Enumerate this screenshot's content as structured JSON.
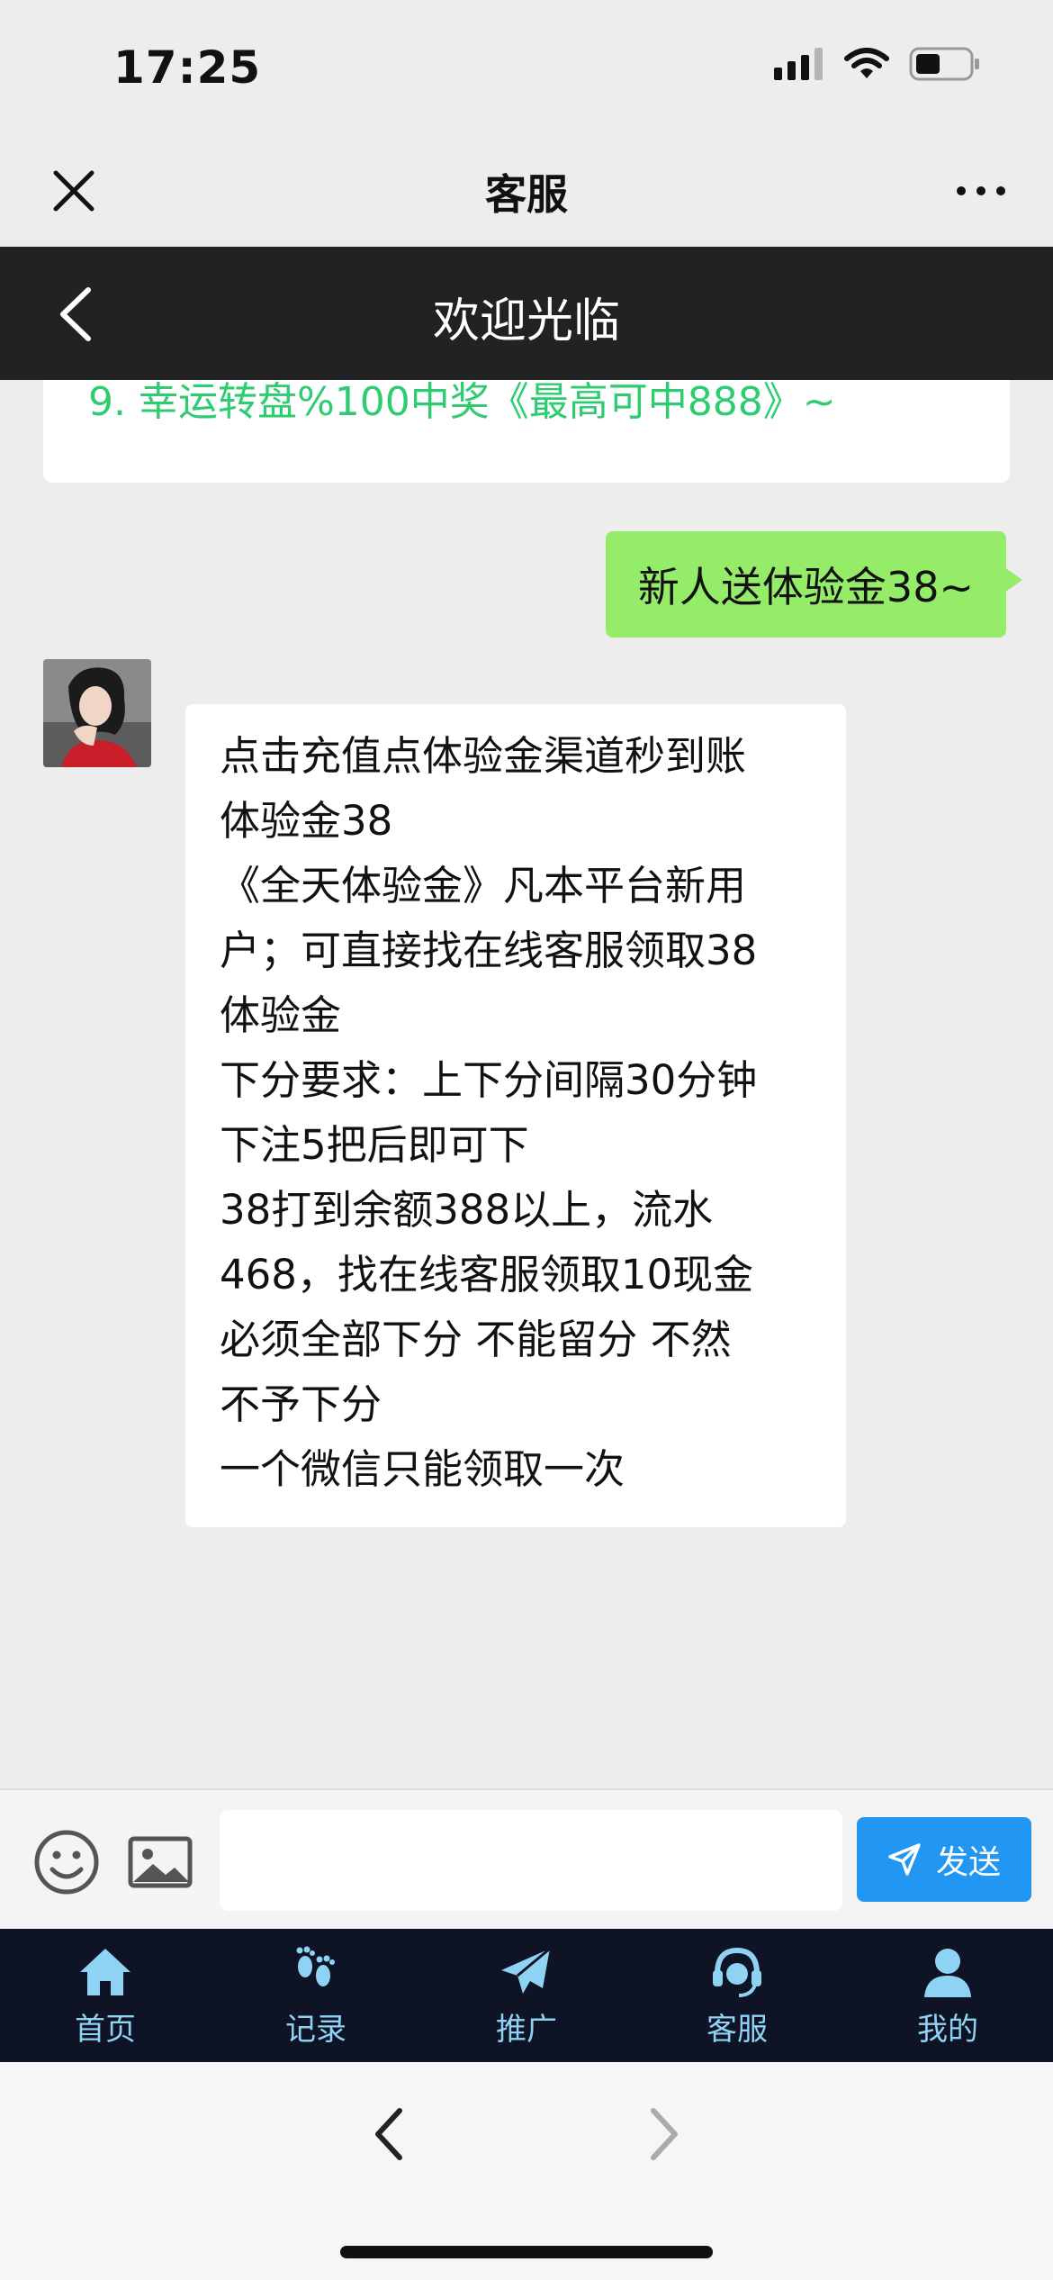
{
  "status": {
    "time": "17:25"
  },
  "wechat": {
    "title": "客服"
  },
  "page": {
    "title": "欢迎光临"
  },
  "chat": {
    "clipped_line": "9. 幸运转盘%100中奖《最高可中888》~",
    "outgoing": "新人送体验金38~",
    "incoming_lines": [
      "点击充值点体验金渠道秒到账",
      "体验金38",
      "《全天体验金》凡本平台新用",
      "户；可直接找在线客服领取38",
      "体验金",
      "下分要求：上下分间隔30分钟",
      "下注5把后即可下",
      "38打到余额388以上，流水",
      "468，找在线客服领取10现金",
      "必须全部下分 不能留分 不然",
      "不予下分",
      "一个微信只能领取一次"
    ]
  },
  "input": {
    "value": "",
    "send_label": "发送"
  },
  "tabs": [
    {
      "label": "首页",
      "icon": "home-icon"
    },
    {
      "label": "记录",
      "icon": "footprint-icon"
    },
    {
      "label": "推广",
      "icon": "paper-plane-icon"
    },
    {
      "label": "客服",
      "icon": "headset-icon"
    },
    {
      "label": "我的",
      "icon": "user-icon"
    }
  ],
  "colors": {
    "accent": "#2196f3",
    "outgoing_bubble": "#95ec69",
    "tab_bar": "#0e1326",
    "tab_label": "#8fd3f4",
    "highlight_text": "#2ecc71"
  }
}
